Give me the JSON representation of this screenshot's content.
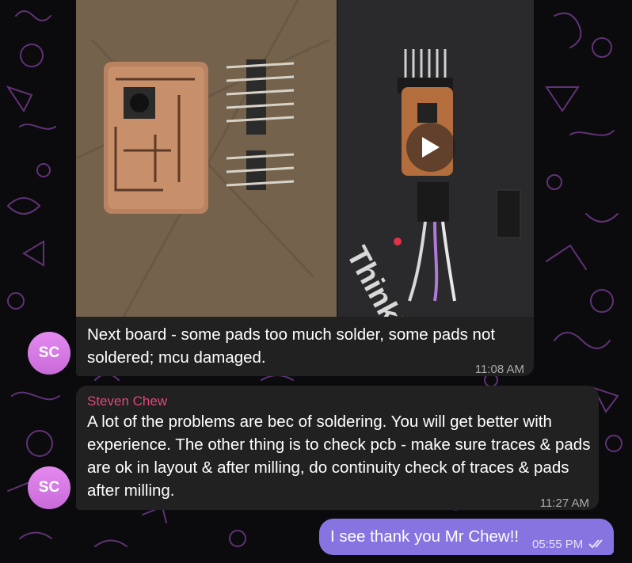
{
  "messages": [
    {
      "avatar_initials": "SC",
      "text": "Next board - some pads too much solder, some pads not soldered; mcu damaged.",
      "time": "11:08 AM"
    },
    {
      "avatar_initials": "SC",
      "sender": "Steven Chew",
      "text": "A lot of the problems are bec of soldering. You will get better with experience. The other thing is to check pcb - make sure traces & pads are ok in layout & after milling, do continuity check of traces & pads after milling.",
      "time": "11:27 AM"
    },
    {
      "text": "I see thank you Mr Chew!!",
      "time": "05:55 PM",
      "status_icon": "double-check-icon"
    }
  ],
  "media": {
    "photo_alt": "milled-pcb-photo",
    "video_icon": "play-icon",
    "video_label": "ThinkPad"
  },
  "colors": {
    "incoming_bubble": "#212121",
    "outgoing_bubble": "#8774e1",
    "sender_name": "#e0487a",
    "avatar": "#d57ae4"
  }
}
